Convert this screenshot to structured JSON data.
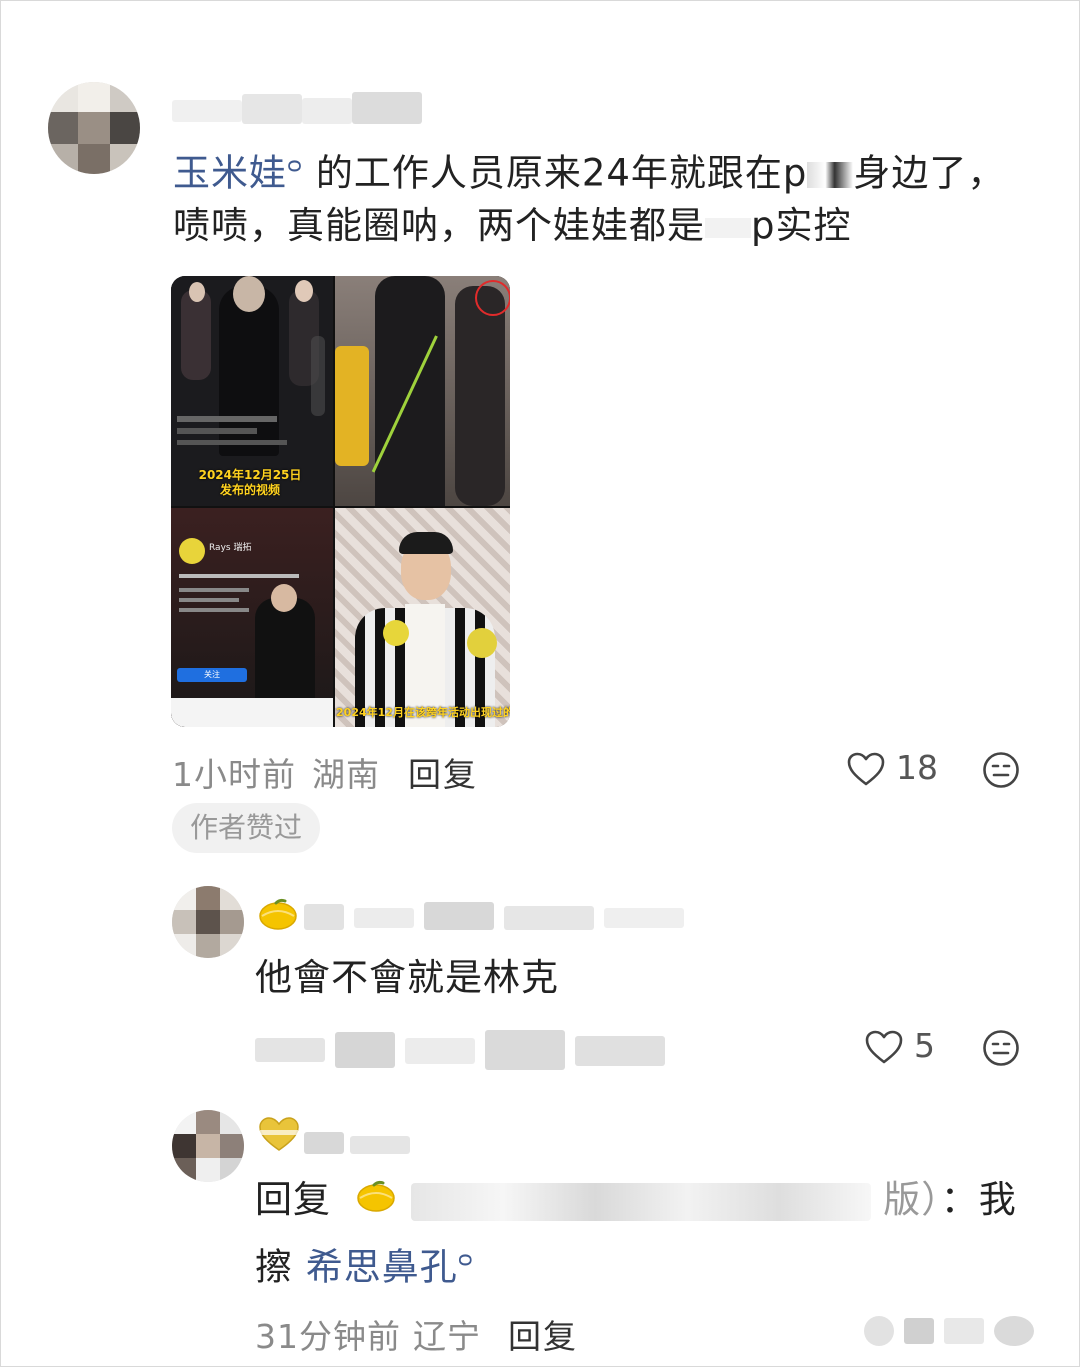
{
  "comment": {
    "mention": "玉米娃",
    "line1_rest": "的工作人员原来24年就跟在p",
    "line1_tail": "身边了，",
    "line2_start": "啧啧，真能圈呐，两个娃娃都是",
    "line2_tail": "p实控",
    "time": "1小时前",
    "location": "湖南",
    "reply_label": "回复",
    "like_count": "18",
    "author_pill": "作者赞过",
    "collage": {
      "caption_top": "2024年12月25日",
      "caption_top_sub": "发布的视频",
      "caption_bottom": "2024年12月在该跨年活动出现过的",
      "profile_name": "Rays 瑞拓",
      "follow_label": "关注"
    }
  },
  "reply1": {
    "text": "他會不會就是林克",
    "like_count": "5"
  },
  "reply2": {
    "prefix": "回复",
    "name_tail": "版）",
    "colon": "：",
    "text_start": "我",
    "line2_start": "擦",
    "mention": "希思鼻孔",
    "time": "31分钟前",
    "location": "辽宁",
    "reply_label": "回复"
  },
  "icons": {
    "like": "heart-outline-icon",
    "dislike": "neutral-face-icon",
    "search": "search-sup-icon",
    "badge": "lemon-badge-icon"
  },
  "colors": {
    "mention": "#3f5a8f",
    "meta": "#8a8a8a",
    "badge_lemon": "#f5c400",
    "badge_heart": "#e9c43a"
  }
}
